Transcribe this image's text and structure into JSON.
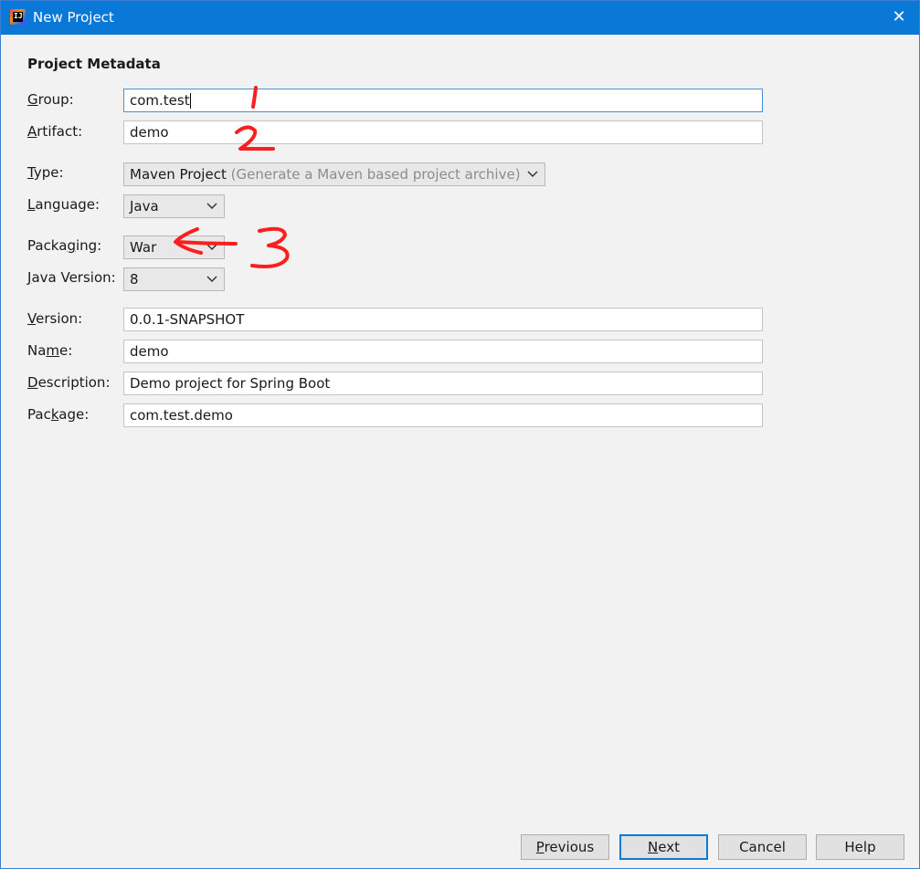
{
  "window": {
    "title": "New Project",
    "app_icon_text": "IJ",
    "close_symbol": "✕"
  },
  "section": {
    "title": "Project Metadata"
  },
  "fields": {
    "group": {
      "label_pre": "",
      "label_key": "G",
      "label_post": "roup:",
      "value": "com.test"
    },
    "artifact": {
      "label_pre": "",
      "label_key": "A",
      "label_post": "rtifact:",
      "value": "demo"
    },
    "type": {
      "label_pre": "",
      "label_key": "T",
      "label_post": "ype:",
      "value": "Maven Project",
      "hint": "(Generate a Maven based project archive)"
    },
    "language": {
      "label_pre": "",
      "label_key": "L",
      "label_post": "anguage:",
      "value": "Java"
    },
    "packaging": {
      "label_pre": "Packa",
      "label_key": "g",
      "label_post": "ing:",
      "value": "War"
    },
    "java_version": {
      "label_pre": "",
      "label_key": "J",
      "label_post": "ava Version:",
      "value": "8"
    },
    "version": {
      "label_pre": "",
      "label_key": "V",
      "label_post": "ersion:",
      "value": "0.0.1-SNAPSHOT"
    },
    "name": {
      "label_pre": "Na",
      "label_key": "m",
      "label_post": "e:",
      "value": "demo"
    },
    "description": {
      "label_pre": "",
      "label_key": "D",
      "label_post": "escription:",
      "value": "Demo project for Spring Boot"
    },
    "package": {
      "label_pre": "Pac",
      "label_key": "k",
      "label_post": "age:",
      "value": "com.test.demo"
    }
  },
  "annotations": {
    "mark1": "1",
    "mark2": "2",
    "mark3": "3"
  },
  "buttons": {
    "previous": {
      "key": "P",
      "rest": "revious"
    },
    "next": {
      "key": "N",
      "rest": "ext"
    },
    "cancel": {
      "label": "Cancel"
    },
    "help": {
      "label": "Help"
    }
  },
  "colors": {
    "titlebar": "#0a78d7",
    "annotation": "#ff1e1e"
  }
}
